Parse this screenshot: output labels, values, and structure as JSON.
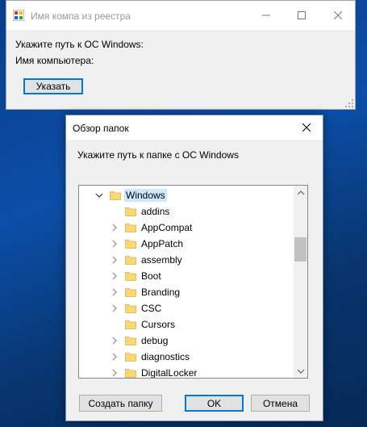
{
  "main_window": {
    "title": "Имя компа из реестра",
    "label_path": "Укажите путь к ОС Windows:",
    "label_name": "Имя компьютера:",
    "button": "Указать"
  },
  "dialog": {
    "title": "Обзор папок",
    "description": "Укажите путь к папке с ОС Windows",
    "tree": {
      "root": {
        "label": "Windows",
        "expanded": true,
        "selected": true
      },
      "items": [
        {
          "label": "addins",
          "has_children": false
        },
        {
          "label": "AppCompat",
          "has_children": true
        },
        {
          "label": "AppPatch",
          "has_children": true
        },
        {
          "label": "assembly",
          "has_children": true
        },
        {
          "label": "Boot",
          "has_children": true
        },
        {
          "label": "Branding",
          "has_children": true
        },
        {
          "label": "CSC",
          "has_children": true
        },
        {
          "label": "Cursors",
          "has_children": false
        },
        {
          "label": "debug",
          "has_children": true
        },
        {
          "label": "diagnostics",
          "has_children": true
        },
        {
          "label": "DigitalLocker",
          "has_children": true
        }
      ]
    },
    "buttons": {
      "create_folder": "Создать папку",
      "ok": "OK",
      "cancel": "Отмена"
    }
  },
  "colors": {
    "accent": "#0078d7",
    "selection": "#cce8ff",
    "folder": "#f8d775"
  }
}
